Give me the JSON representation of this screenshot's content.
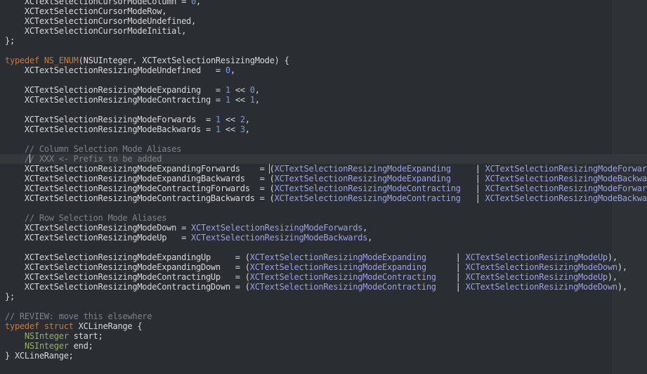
{
  "editor": {
    "language": "objective-c",
    "lines": [
      [
        [
          "t",
          "    XCTextSelectionCursorModeColumn = "
        ],
        [
          "num",
          "0"
        ],
        [
          "t",
          ","
        ]
      ],
      [
        [
          "t",
          "    XCTextSelectionCursorModeRow,"
        ]
      ],
      [
        [
          "t",
          "    XCTextSelectionCursorModeUndefined,"
        ]
      ],
      [
        [
          "t",
          "    XCTextSelectionCursorModeInitial,"
        ]
      ],
      [
        [
          "t",
          "};"
        ]
      ],
      [],
      [
        [
          "kw",
          "typedef"
        ],
        [
          "t",
          " "
        ],
        [
          "macro",
          "NS_ENUM"
        ],
        [
          "t",
          "(NSUInteger, XCTextSelectionResizingMode) {"
        ]
      ],
      [
        [
          "t",
          "    XCTextSelectionResizingModeUndefined   = "
        ],
        [
          "num",
          "0"
        ],
        [
          "t",
          ","
        ]
      ],
      [],
      [
        [
          "t",
          "    XCTextSelectionResizingModeExpanding   = "
        ],
        [
          "num",
          "1"
        ],
        [
          "t",
          " << "
        ],
        [
          "num",
          "0"
        ],
        [
          "t",
          ","
        ]
      ],
      [
        [
          "t",
          "    XCTextSelectionResizingModeContracting = "
        ],
        [
          "num",
          "1"
        ],
        [
          "t",
          " << "
        ],
        [
          "num",
          "1"
        ],
        [
          "t",
          ","
        ]
      ],
      [],
      [
        [
          "t",
          "    XCTextSelectionResizingModeForwards  = "
        ],
        [
          "num",
          "1"
        ],
        [
          "t",
          " << "
        ],
        [
          "num",
          "2"
        ],
        [
          "t",
          ","
        ]
      ],
      [
        [
          "t",
          "    XCTextSelectionResizingModeBackwards = "
        ],
        [
          "num",
          "1"
        ],
        [
          "t",
          " << "
        ],
        [
          "num",
          "3"
        ],
        [
          "t",
          ","
        ]
      ],
      [],
      [
        [
          "cm",
          "    // Column Selection Mode Aliases"
        ]
      ],
      [
        [
          "cm",
          "    /"
        ],
        [
          "caret",
          ""
        ],
        [
          "cm",
          "/ XXX <- Prefix to be added"
        ]
      ],
      [
        [
          "t",
          "    XCTextSelectionResizingModeExpandingForwards    = "
        ],
        [
          "ibeam",
          ""
        ],
        [
          "t",
          "("
        ],
        [
          "ref",
          "XCTextSelectionResizingModeExpanding"
        ],
        [
          "t",
          "     | "
        ],
        [
          "ref",
          "XCTextSelectionResizingModeForwards"
        ]
      ],
      [
        [
          "t",
          "    XCTextSelectionResizingModeExpandingBackwards   = ("
        ],
        [
          "ref",
          "XCTextSelectionResizingModeExpanding"
        ],
        [
          "t",
          "     | "
        ],
        [
          "ref",
          "XCTextSelectionResizingModeBackwards"
        ]
      ],
      [
        [
          "t",
          "    XCTextSelectionResizingModeContractingForwards  = ("
        ],
        [
          "ref",
          "XCTextSelectionResizingModeContracting"
        ],
        [
          "t",
          "   | "
        ],
        [
          "ref",
          "XCTextSelectionResizingModeForwards"
        ]
      ],
      [
        [
          "t",
          "    XCTextSelectionResizingModeContractingBackwards = ("
        ],
        [
          "ref",
          "XCTextSelectionResizingModeContracting"
        ],
        [
          "t",
          "   | "
        ],
        [
          "ref",
          "XCTextSelectionResizingModeBackwards"
        ]
      ],
      [],
      [
        [
          "cm",
          "    // Row Selection Mode Aliases"
        ]
      ],
      [
        [
          "t",
          "    XCTextSelectionResizingModeDown = "
        ],
        [
          "ref",
          "XCTextSelectionResizingModeForwards"
        ],
        [
          "t",
          ","
        ]
      ],
      [
        [
          "t",
          "    XCTextSelectionResizingModeUp   = "
        ],
        [
          "ref",
          "XCTextSelectionResizingModeBackwards"
        ],
        [
          "t",
          ","
        ]
      ],
      [],
      [
        [
          "t",
          "    XCTextSelectionResizingModeExpandingUp     = ("
        ],
        [
          "ref",
          "XCTextSelectionResizingModeExpanding"
        ],
        [
          "t",
          "      | "
        ],
        [
          "ref",
          "XCTextSelectionResizingModeUp"
        ],
        [
          "t",
          "),"
        ]
      ],
      [
        [
          "t",
          "    XCTextSelectionResizingModeExpandingDown   = ("
        ],
        [
          "ref",
          "XCTextSelectionResizingModeExpanding"
        ],
        [
          "t",
          "      | "
        ],
        [
          "ref",
          "XCTextSelectionResizingModeDown"
        ],
        [
          "t",
          "),"
        ]
      ],
      [
        [
          "t",
          "    XCTextSelectionResizingModeContractingUp   = ("
        ],
        [
          "ref",
          "XCTextSelectionResizingModeContracting"
        ],
        [
          "t",
          "    | "
        ],
        [
          "ref",
          "XCTextSelectionResizingModeUp"
        ],
        [
          "t",
          "),"
        ]
      ],
      [
        [
          "t",
          "    XCTextSelectionResizingModeContractingDown = ("
        ],
        [
          "ref",
          "XCTextSelectionResizingModeContracting"
        ],
        [
          "t",
          "    | "
        ],
        [
          "ref",
          "XCTextSelectionResizingModeDown"
        ],
        [
          "t",
          "),"
        ]
      ],
      [
        [
          "t",
          "};"
        ]
      ],
      [],
      [
        [
          "cm",
          "// REVIEW: move this elsewhere"
        ]
      ],
      [
        [
          "kw",
          "typedef"
        ],
        [
          "t",
          " "
        ],
        [
          "kw",
          "struct"
        ],
        [
          "t",
          " XCLineRange {"
        ]
      ],
      [
        [
          "t",
          "    "
        ],
        [
          "type",
          "NSInteger"
        ],
        [
          "t",
          " start;"
        ]
      ],
      [
        [
          "t",
          "    "
        ],
        [
          "type",
          "NSInteger"
        ],
        [
          "t",
          " end;"
        ]
      ],
      [
        [
          "t",
          "} XCLineRange;"
        ]
      ]
    ],
    "current_line_index": 16
  },
  "colors": {
    "background": "#2a2d31",
    "keyword": "#cc7832",
    "number": "#6c9ef8",
    "reference": "#9a9ff0",
    "comment": "#7e8389",
    "type": "#8fb35a",
    "text": "#d6d8da"
  }
}
